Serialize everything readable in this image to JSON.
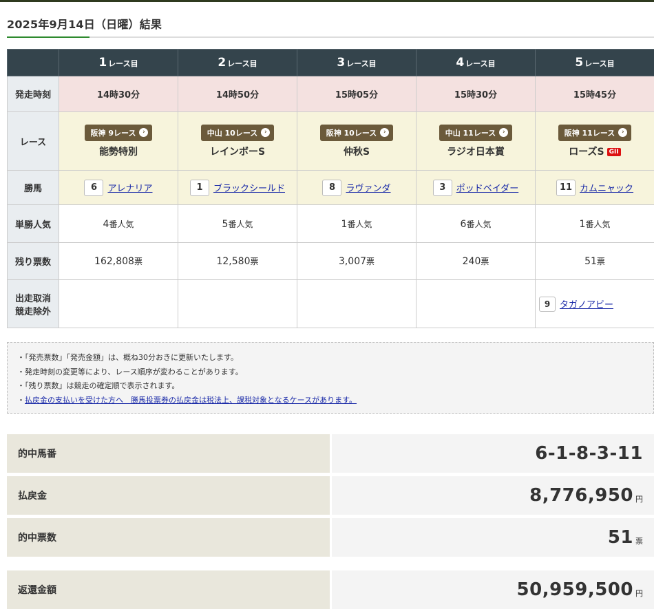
{
  "page": {
    "title": "2025年9月14日（日曜）結果"
  },
  "table": {
    "row_labels": {
      "start": "発走時刻",
      "race": "レース",
      "winner": "勝馬",
      "popularity": "単勝人気",
      "remaining": "残り票数",
      "scratch_line1": "出走取消",
      "scratch_line2": "競走除外"
    },
    "races": [
      {
        "num": "1",
        "label": "レース目",
        "start_time": "14時30分",
        "venue": "阪神 9レース",
        "name": "能勢特別",
        "grade": "",
        "horse_num": "6",
        "horse_name": "アレナリア",
        "pop_num": "4",
        "pop_unit": "番人気",
        "left_num": "162,808",
        "left_unit": "票"
      },
      {
        "num": "2",
        "label": "レース目",
        "start_time": "14時50分",
        "venue": "中山 10レース",
        "name": "レインボーS",
        "grade": "",
        "horse_num": "1",
        "horse_name": "ブラックシールド",
        "pop_num": "5",
        "pop_unit": "番人気",
        "left_num": "12,580",
        "left_unit": "票"
      },
      {
        "num": "3",
        "label": "レース目",
        "start_time": "15時05分",
        "venue": "阪神 10レース",
        "name": "仲秋S",
        "grade": "",
        "horse_num": "8",
        "horse_name": "ラヴァンダ",
        "pop_num": "1",
        "pop_unit": "番人気",
        "left_num": "3,007",
        "left_unit": "票"
      },
      {
        "num": "4",
        "label": "レース目",
        "start_time": "15時30分",
        "venue": "中山 11レース",
        "name": "ラジオ日本賞",
        "grade": "",
        "horse_num": "3",
        "horse_name": "ポッドベイダー",
        "pop_num": "6",
        "pop_unit": "番人気",
        "left_num": "240",
        "left_unit": "票"
      },
      {
        "num": "5",
        "label": "レース目",
        "start_time": "15時45分",
        "venue": "阪神 11レース",
        "name": "ローズS",
        "grade": "GII",
        "horse_num": "11",
        "horse_name": "カムニャック",
        "pop_num": "1",
        "pop_unit": "番人気",
        "left_num": "51",
        "left_unit": "票",
        "scratch_num": "9",
        "scratch_name": "タガノアビー"
      }
    ]
  },
  "notes": {
    "items": [
      "「発売票数」「発売金額」は、概ね30分おきに更新いたします。",
      "発走時刻の変更等により、レース順序が変わることがあります。",
      "「残り票数」は競走の確定順で表示されます。"
    ],
    "link": "払戻金の支払いを受けた方へ　勝馬投票券の払戻金は税法上、課税対象となるケースがあります。"
  },
  "summary": {
    "hit_numbers": {
      "label": "的中馬番",
      "value": "6-1-8-3-11",
      "unit": ""
    },
    "payout": {
      "label": "払戻金",
      "value": "8,776,950",
      "unit": "円"
    },
    "hit_tickets": {
      "label": "的中票数",
      "value": "51",
      "unit": "票"
    },
    "refund": {
      "label": "返還金額",
      "value": "50,959,500",
      "unit": "円"
    }
  },
  "colors": {
    "header_bg": "#34444c",
    "start_row_bg": "#f4e1e0",
    "race_row_bg": "#f7f4dc",
    "badge_bg": "#6b5a3b",
    "grade_bg": "#dd1111",
    "link": "#1a2aa8",
    "title_accent": "#2f8a2f"
  }
}
